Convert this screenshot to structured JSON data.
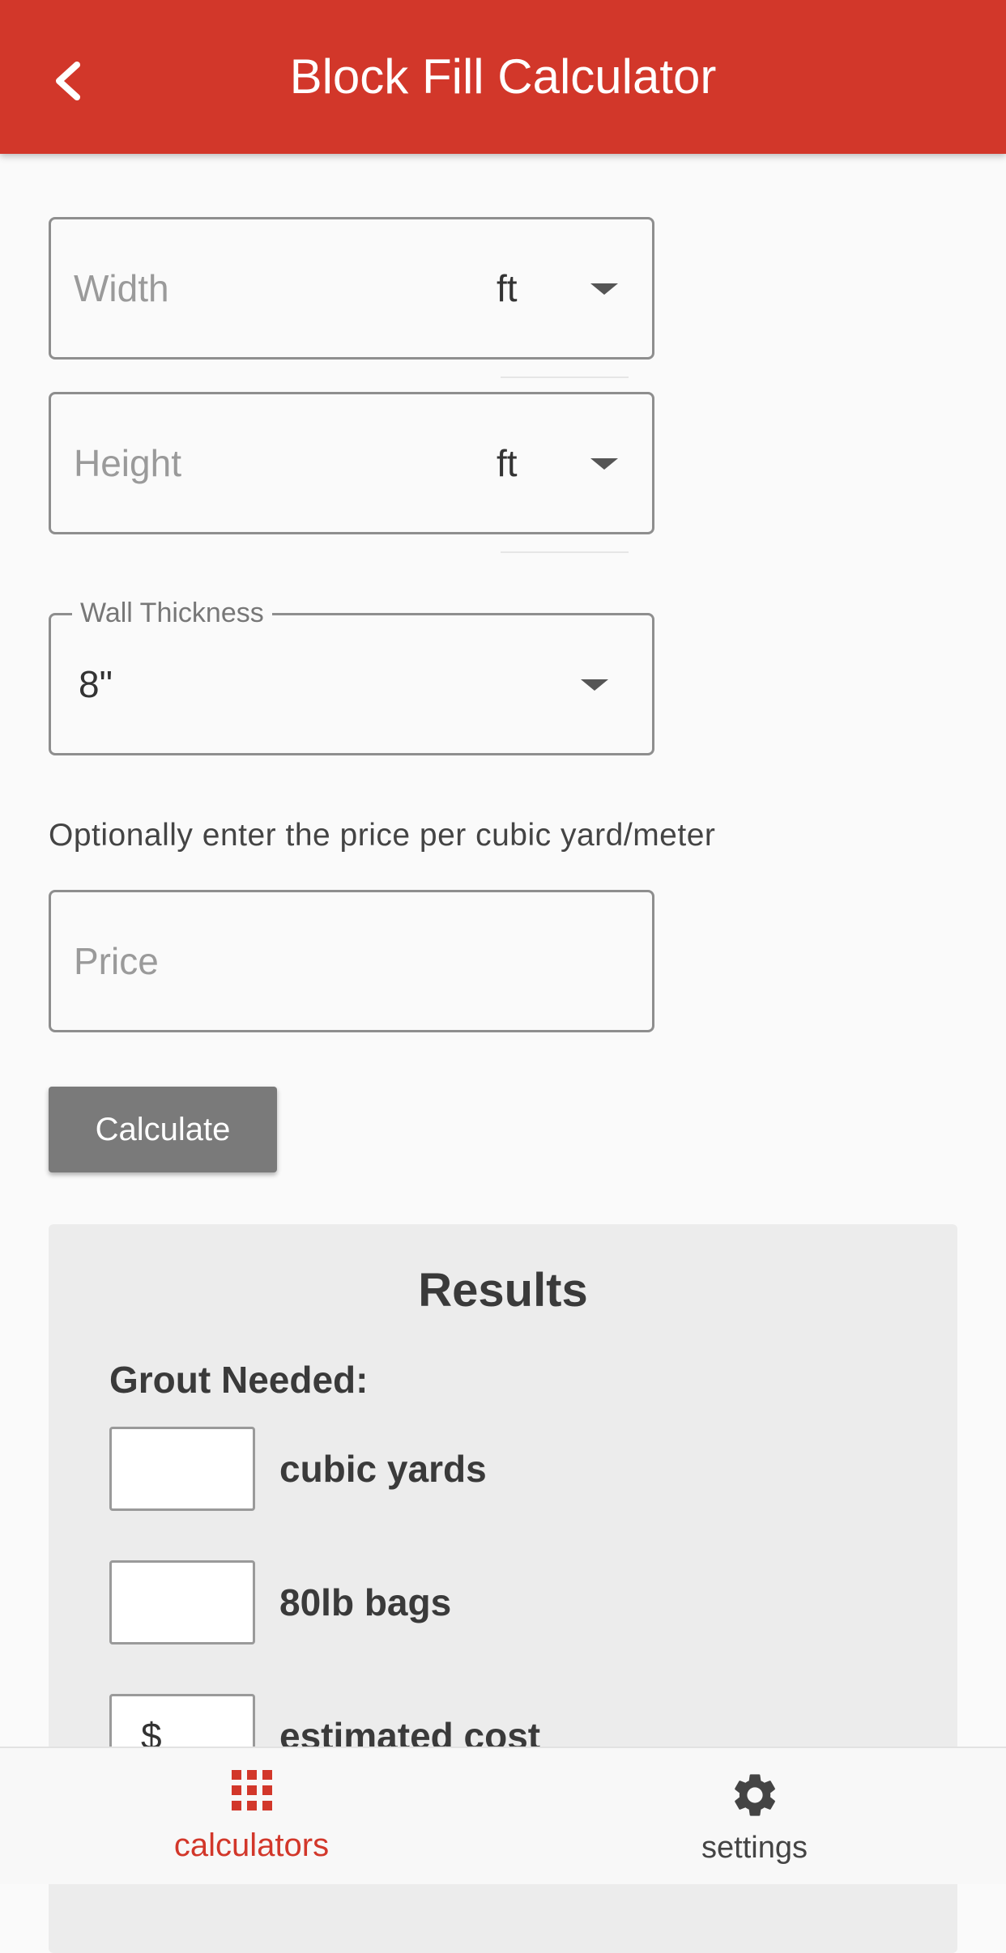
{
  "header": {
    "title": "Block Fill Calculator",
    "back_icon": "chevron-left-icon"
  },
  "form": {
    "width": {
      "placeholder": "Width",
      "unit": "ft"
    },
    "height": {
      "placeholder": "Height",
      "unit": "ft"
    },
    "wall_thickness": {
      "label": "Wall Thickness",
      "value": "8\""
    },
    "helper_text": "Optionally enter the price per cubic yard/meter",
    "price": {
      "placeholder": "Price"
    },
    "calculate_label": "Calculate"
  },
  "results": {
    "title": "Results",
    "grout_label": "Grout Needed:",
    "rows": [
      {
        "prefix": "",
        "label": "cubic yards"
      },
      {
        "prefix": "",
        "label": "80lb bags"
      },
      {
        "prefix": "$",
        "label": "estimated cost"
      }
    ]
  },
  "bottom_nav": {
    "items": [
      {
        "label": "calculators",
        "icon": "grid-icon",
        "active": true
      },
      {
        "label": "settings",
        "icon": "gear-icon",
        "active": false
      }
    ]
  },
  "colors": {
    "primary": "#d2372a",
    "button_gray": "#7a7a7a",
    "results_bg": "#ececec"
  }
}
